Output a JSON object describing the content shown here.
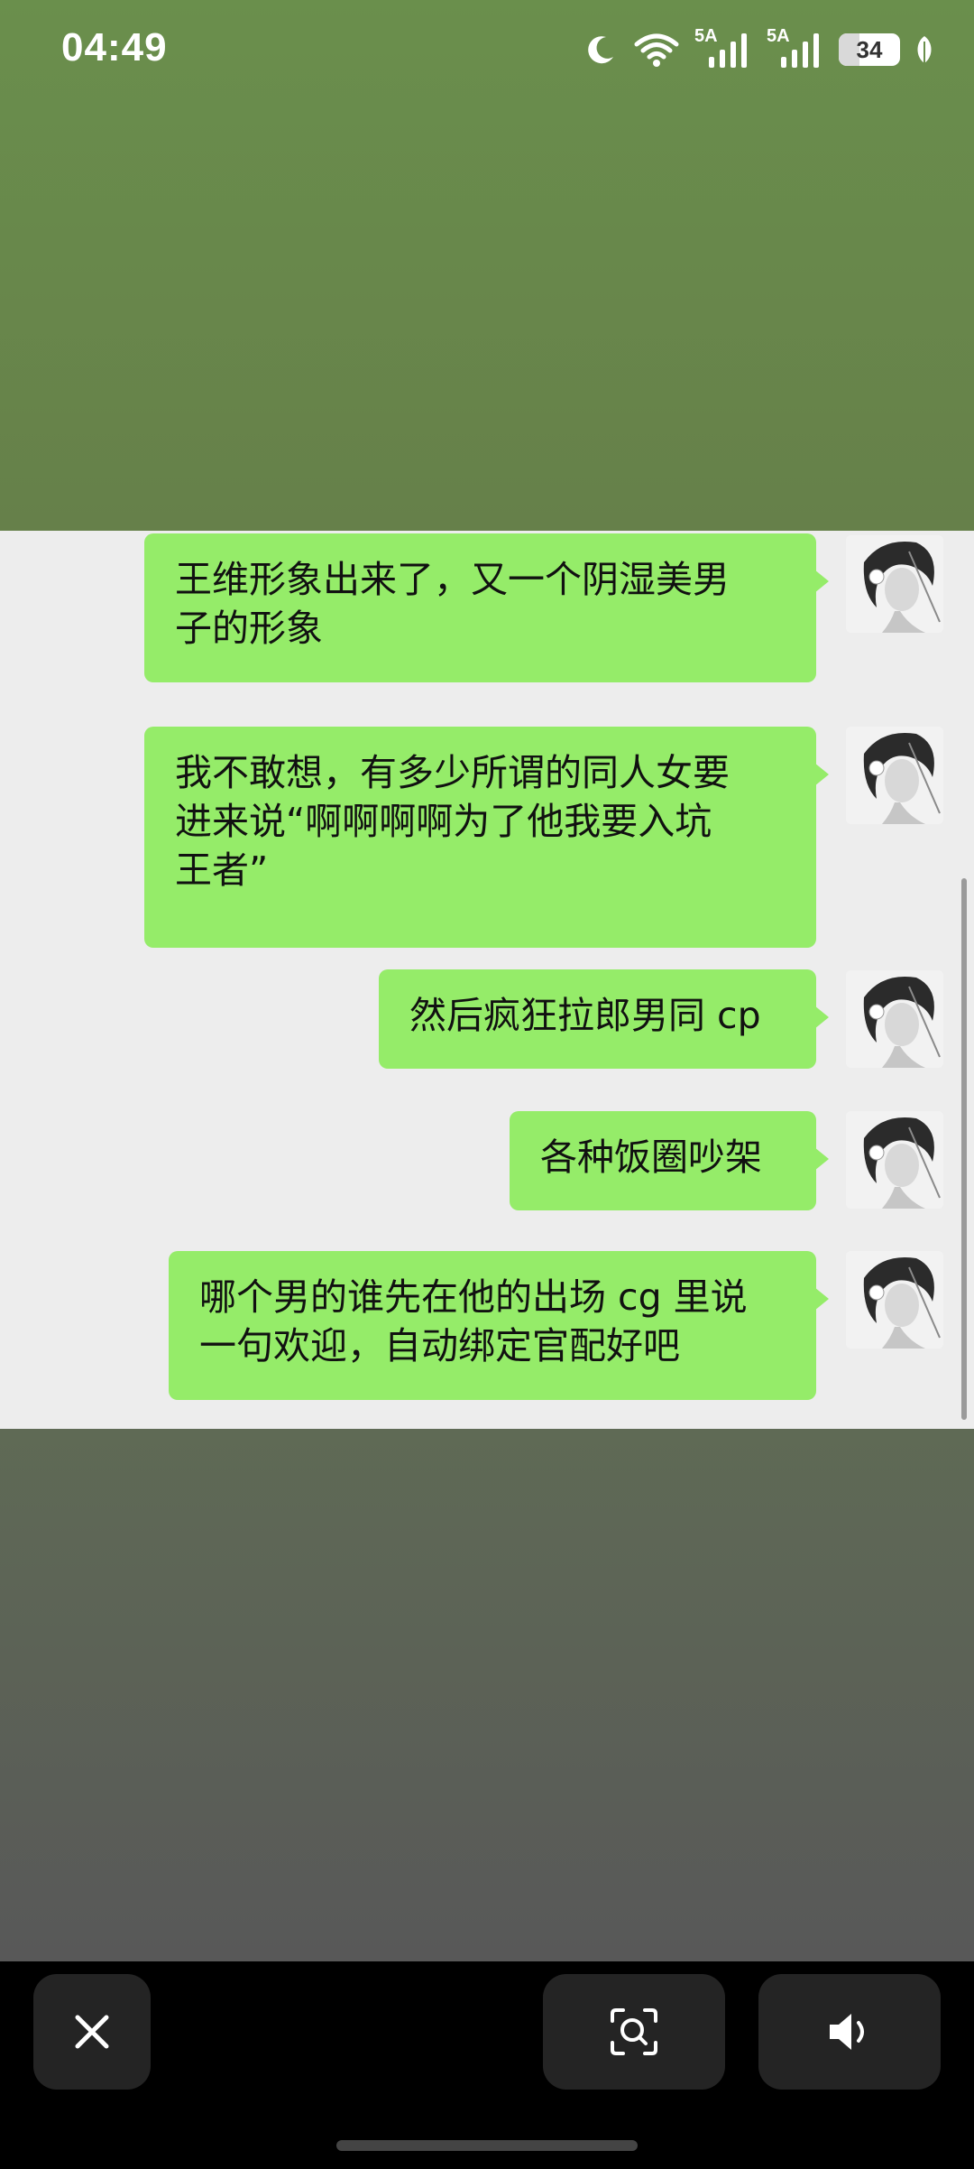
{
  "status_bar": {
    "time": "04:49",
    "signal1_label": "5A",
    "signal2_label": "5A",
    "battery_percent": "34",
    "battery_level": 0.34
  },
  "messages": [
    {
      "lines": [
        "王维形象出来了，又一个阴湿美男",
        "子的形象"
      ]
    },
    {
      "lines": [
        "我不敢想，有多少所谓的同人女要",
        "进来说“啊啊啊啊为了他我要入坑",
        "王者”"
      ]
    },
    {
      "lines": [
        "然后疯狂拉郎男同 cp"
      ]
    },
    {
      "lines": [
        "各种饭圈吵架"
      ]
    },
    {
      "lines": [
        "哪个男的谁先在他的出场 cg 里说",
        "一句欢迎，自动绑定官配好吧"
      ]
    }
  ],
  "icons": {
    "close": "close-icon",
    "scan": "scan-search-icon",
    "speaker": "speaker-icon"
  },
  "colors": {
    "bubble": "#95ec69",
    "chat_bg": "#ededed",
    "top_bg": "#6a8f4c",
    "bottom_bg": "#585858"
  }
}
